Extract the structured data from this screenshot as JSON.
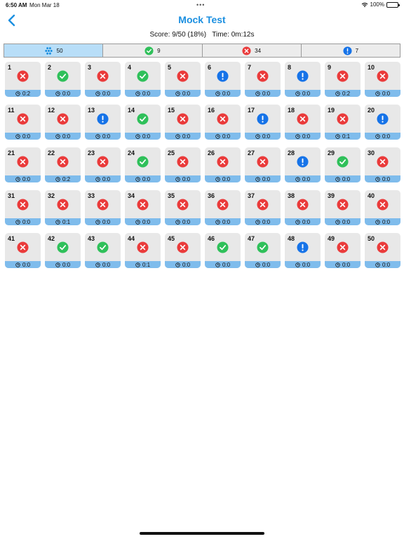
{
  "status_bar": {
    "time": "6:50 AM",
    "date": "Mon Mar 18",
    "battery": "100%"
  },
  "nav": {
    "title": "Mock Test"
  },
  "score": {
    "score_label": "Score:",
    "score_value": "9/50 (18%)",
    "time_label": "Time:",
    "time_value": "0m:12s"
  },
  "tabs": [
    {
      "icon": "all-icon",
      "count": "50"
    },
    {
      "icon": "correct-icon",
      "count": "9"
    },
    {
      "icon": "wrong-icon",
      "count": "34"
    },
    {
      "icon": "skipped-icon",
      "count": "7"
    }
  ],
  "colors": {
    "accent": "#1b8fe0",
    "correct": "#2fc05a",
    "wrong": "#ea3b3b",
    "skipped": "#1673e8",
    "timebar": "#7fbcec",
    "active_tab": "#b8def8"
  },
  "questions": [
    {
      "n": "1",
      "s": "wrong",
      "t": "0:2"
    },
    {
      "n": "2",
      "s": "correct",
      "t": "0:0"
    },
    {
      "n": "3",
      "s": "wrong",
      "t": "0:0"
    },
    {
      "n": "4",
      "s": "correct",
      "t": "0:0"
    },
    {
      "n": "5",
      "s": "wrong",
      "t": "0:0"
    },
    {
      "n": "6",
      "s": "skipped",
      "t": "0:0"
    },
    {
      "n": "7",
      "s": "wrong",
      "t": "0:0"
    },
    {
      "n": "8",
      "s": "skipped",
      "t": "0:0"
    },
    {
      "n": "9",
      "s": "wrong",
      "t": "0:2"
    },
    {
      "n": "10",
      "s": "wrong",
      "t": "0:0"
    },
    {
      "n": "11",
      "s": "wrong",
      "t": "0:0"
    },
    {
      "n": "12",
      "s": "wrong",
      "t": "0:0"
    },
    {
      "n": "13",
      "s": "skipped",
      "t": "0:0"
    },
    {
      "n": "14",
      "s": "correct",
      "t": "0:0"
    },
    {
      "n": "15",
      "s": "wrong",
      "t": "0:0"
    },
    {
      "n": "16",
      "s": "wrong",
      "t": "0:0"
    },
    {
      "n": "17",
      "s": "skipped",
      "t": "0:0"
    },
    {
      "n": "18",
      "s": "wrong",
      "t": "0:0"
    },
    {
      "n": "19",
      "s": "wrong",
      "t": "0:1"
    },
    {
      "n": "20",
      "s": "skipped",
      "t": "0:0"
    },
    {
      "n": "21",
      "s": "wrong",
      "t": "0:0"
    },
    {
      "n": "22",
      "s": "wrong",
      "t": "0:2"
    },
    {
      "n": "23",
      "s": "wrong",
      "t": "0:0"
    },
    {
      "n": "24",
      "s": "correct",
      "t": "0:0"
    },
    {
      "n": "25",
      "s": "wrong",
      "t": "0:0"
    },
    {
      "n": "26",
      "s": "wrong",
      "t": "0:0"
    },
    {
      "n": "27",
      "s": "wrong",
      "t": "0:0"
    },
    {
      "n": "28",
      "s": "skipped",
      "t": "0:0"
    },
    {
      "n": "29",
      "s": "correct",
      "t": "0:0"
    },
    {
      "n": "30",
      "s": "wrong",
      "t": "0:0"
    },
    {
      "n": "31",
      "s": "wrong",
      "t": "0:0"
    },
    {
      "n": "32",
      "s": "wrong",
      "t": "0:1"
    },
    {
      "n": "33",
      "s": "wrong",
      "t": "0:0"
    },
    {
      "n": "34",
      "s": "wrong",
      "t": "0:0"
    },
    {
      "n": "35",
      "s": "wrong",
      "t": "0:0"
    },
    {
      "n": "36",
      "s": "wrong",
      "t": "0:0"
    },
    {
      "n": "37",
      "s": "wrong",
      "t": "0:0"
    },
    {
      "n": "38",
      "s": "wrong",
      "t": "0:0"
    },
    {
      "n": "39",
      "s": "wrong",
      "t": "0:0"
    },
    {
      "n": "40",
      "s": "wrong",
      "t": "0:0"
    },
    {
      "n": "41",
      "s": "wrong",
      "t": "0:0"
    },
    {
      "n": "42",
      "s": "correct",
      "t": "0:0"
    },
    {
      "n": "43",
      "s": "correct",
      "t": "0:0"
    },
    {
      "n": "44",
      "s": "wrong",
      "t": "0:1"
    },
    {
      "n": "45",
      "s": "wrong",
      "t": "0:0"
    },
    {
      "n": "46",
      "s": "correct",
      "t": "0:0"
    },
    {
      "n": "47",
      "s": "correct",
      "t": "0:0"
    },
    {
      "n": "48",
      "s": "skipped",
      "t": "0:0"
    },
    {
      "n": "49",
      "s": "wrong",
      "t": "0:0"
    },
    {
      "n": "50",
      "s": "wrong",
      "t": "0:0"
    }
  ]
}
